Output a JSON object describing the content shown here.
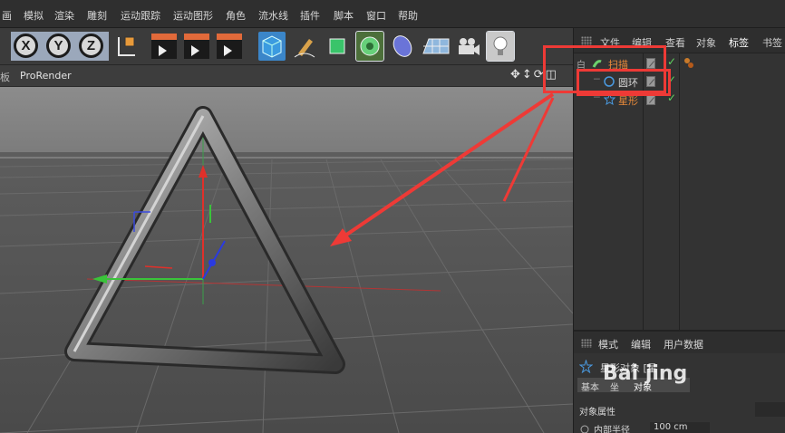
{
  "menu": [
    "画",
    "模拟",
    "渲染",
    "雕刻",
    "运动跟踪",
    "运动图形",
    "角色",
    "流水线",
    "插件",
    "脚本",
    "窗口",
    "帮助"
  ],
  "toolbar": {
    "axis_x": "X",
    "axis_y": "Y",
    "axis_z": "Z",
    "icons": [
      "coordinate-system-icon",
      "render-view-icon",
      "render-picture-viewer-icon",
      "render-settings-icon",
      "cube-icon",
      "pen-icon",
      "subdivision-icon",
      "cloner-icon",
      "deformer-icon",
      "floor-icon",
      "camera-icon",
      "light-icon"
    ]
  },
  "viewport": {
    "left_label": "板",
    "renderer": "ProRender",
    "nav_icons": "✥↕⟳◫"
  },
  "object_manager": {
    "tabs": [
      "文件",
      "编辑",
      "查看",
      "对象",
      "标签",
      "书签"
    ],
    "objects": [
      {
        "name": "扫描",
        "color": "#e88a3a",
        "icon": "sweep-icon"
      },
      {
        "name": "圆环",
        "color": "#d7d7d7",
        "icon": "circle-icon"
      },
      {
        "name": "星形",
        "color": "#e88a3a",
        "icon": "star-icon"
      }
    ],
    "check_mark": "✓",
    "tree_root_mark": "白"
  },
  "attributes": {
    "tabs": [
      "模式",
      "编辑",
      "用户数据"
    ],
    "title": "星形对象 [星",
    "sub_tabs": [
      "基本",
      "坐",
      "对象"
    ],
    "section": "对象属性",
    "field_label": "内部半径",
    "field_value": "100 cm"
  },
  "watermark": "Bai jing",
  "colors": {
    "accent_red": "#ee3a36",
    "orange_label": "#e88a3a",
    "check_green": "#5fd35f"
  }
}
